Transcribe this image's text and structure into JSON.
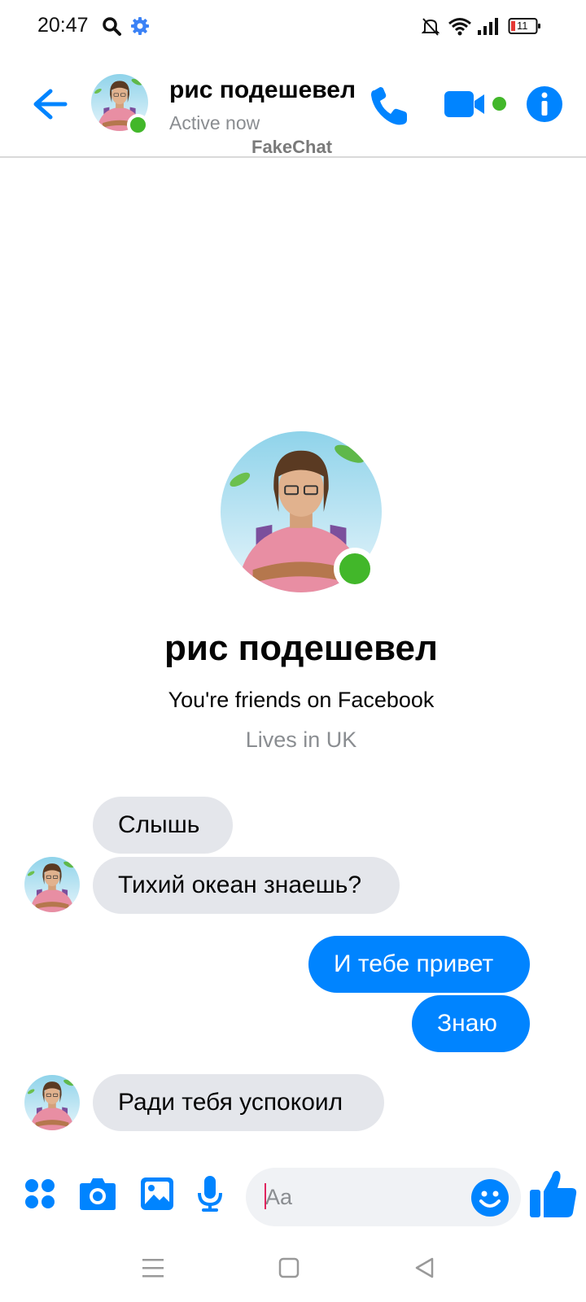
{
  "status_bar": {
    "time": "20:47",
    "battery": "11",
    "icons": [
      "search-icon",
      "gear-icon",
      "mute-icon",
      "wifi-icon",
      "signal-icon",
      "battery-icon"
    ]
  },
  "header": {
    "name": "рис подешевел",
    "status": "Active now",
    "watermark": "FakeChat"
  },
  "profile": {
    "name": "рис подешевел",
    "friends_text": "You're friends on Facebook",
    "location": "Lives in UK"
  },
  "messages": [
    {
      "direction": "incoming",
      "text": "Слышь"
    },
    {
      "direction": "incoming",
      "text": "Тихий океан знаешь?"
    },
    {
      "direction": "outgoing",
      "text": "И тебе привет"
    },
    {
      "direction": "outgoing",
      "text": "Знаю"
    },
    {
      "direction": "incoming",
      "text": "Ради тебя успокоил"
    }
  ],
  "composer": {
    "placeholder": "Aa"
  },
  "colors": {
    "accent": "#0084ff",
    "online": "#42b72a",
    "incoming_bubble": "#e4e6eb"
  }
}
